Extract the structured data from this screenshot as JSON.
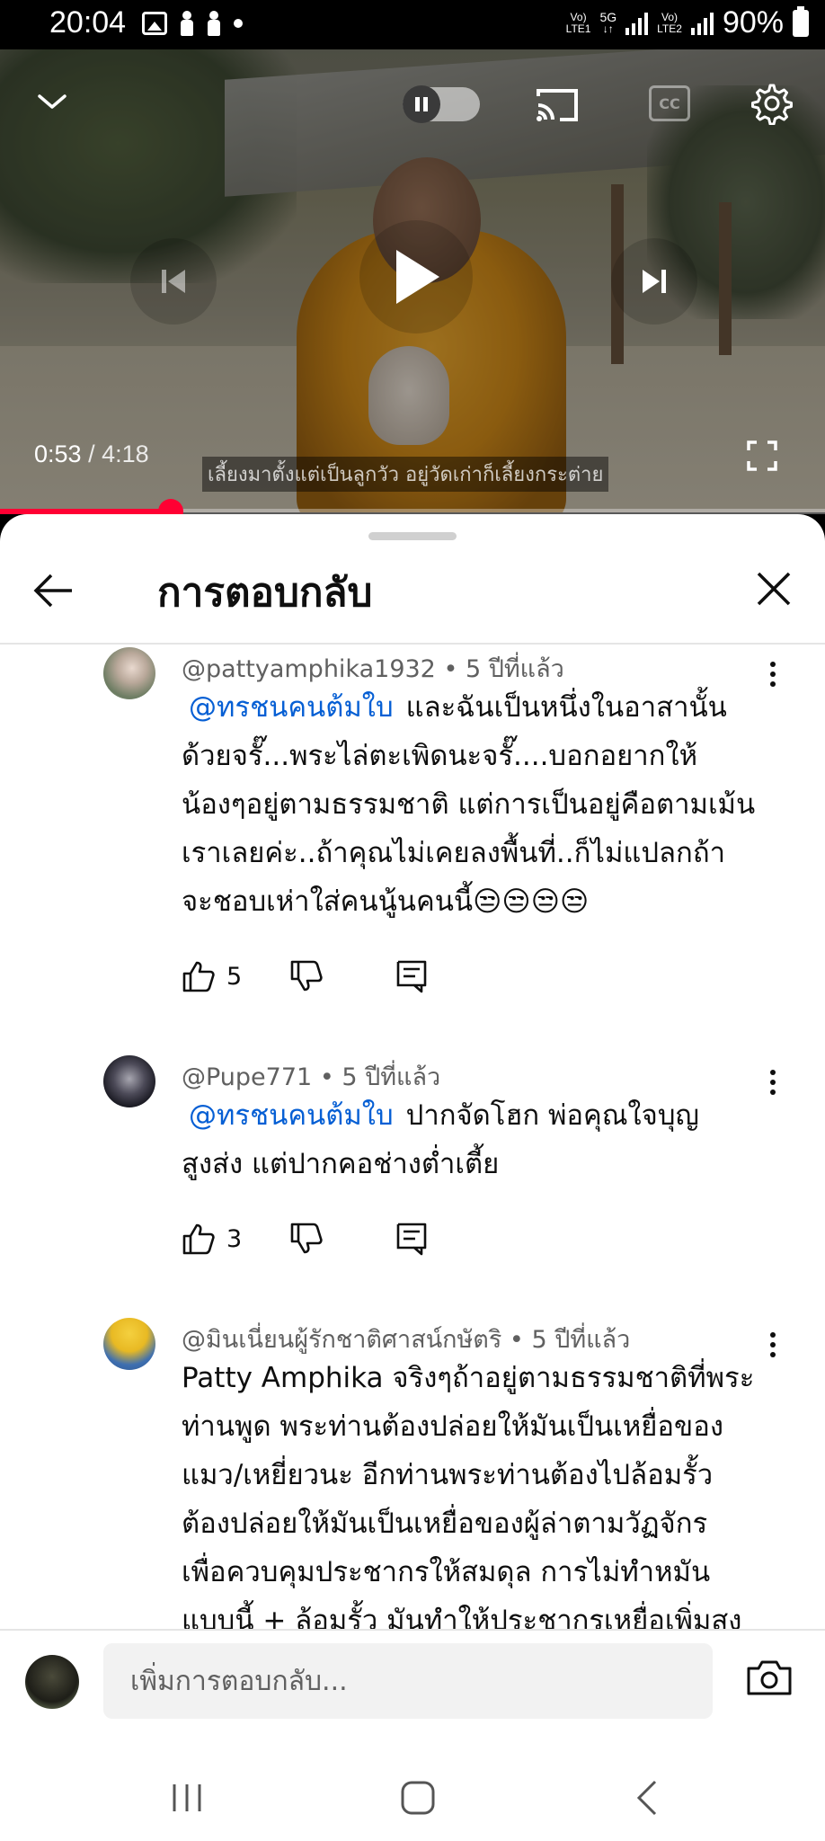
{
  "status_bar": {
    "time": "20:04",
    "net1_top": "Vo)",
    "net1_bottom": "LTE1",
    "net_5g": "5G",
    "net2_top": "Vo)",
    "net2_bottom": "LTE2",
    "battery": "90%"
  },
  "player": {
    "current_time": "0:53",
    "separator": "/",
    "duration": "4:18",
    "progress_fraction": 0.2072,
    "subtitle": "เลี้ยงมาตั้งแต่เป็นลูกวัว อยู่วัดเก่าก็เลี้ยงกระต่าย",
    "cc_label": "CC",
    "accent_color": "#ff0033"
  },
  "sheet": {
    "title": "การตอบกลับ"
  },
  "comments": [
    {
      "handle": "@pattyamphika1932",
      "age": "5 ปีที่แล้ว",
      "mention": "@ทรชนคนต้มใบ",
      "lines": [
        "และฉันเป็นหนึ่งในอาสานั้น",
        "ด้วยจรั๊...พระไล่ตะเพิดนะจรั๊....บอกอยากให้",
        "น้องๆอยู่ตามธรรมชาติ แต่การเป็นอยู่คือตามเม้น",
        "เราเลยค่ะ..ถ้าคุณไม่เคยลงพื้นที่..ก็ไม่แปลกถ้า",
        "จะชอบเห่าใส่คนนู้นคนนี้😒😒😒😒"
      ],
      "likes": "5"
    },
    {
      "handle": "@Pupe771",
      "age": "5 ปีที่แล้ว",
      "mention": "@ทรชนคนต้มใบ",
      "lines": [
        "ปากจัดโฮก พ่อคุณใจบุญ",
        "สูงส่ง แต่ปากคอช่างต่ำเตี้ย"
      ],
      "likes": "3"
    },
    {
      "handle": "@มินเนี่ยนผู้รักชาติศาสน์กษัตริ",
      "age": "5 ปีที่แล้ว",
      "mention": "",
      "lines": [
        "Patty Amphika จริงๆถ้าอยู่ตามธรรมชาติที่พระ",
        "ท่านพูด พระท่านต้องปล่อยให้มันเป็นเหยื่อของ",
        "แมว/เหยี่ยวนะ อีกท่านพระท่านต้องไปล้อมรั้ว",
        "ต้องปล่อยให้มันเป็นเหยื่อของผู้ล่าตามวัฏจักร",
        "เพื่อควบคุมประชากรให้สมดุล การไม่ทำหมัน",
        "แบบนี้ + ล้อมรั้ว มันทำให้ประชากรเหยื่อเพิ่มสูง"
      ],
      "likes": ""
    }
  ],
  "composer": {
    "placeholder": "เพิ่มการตอบกลับ..."
  }
}
